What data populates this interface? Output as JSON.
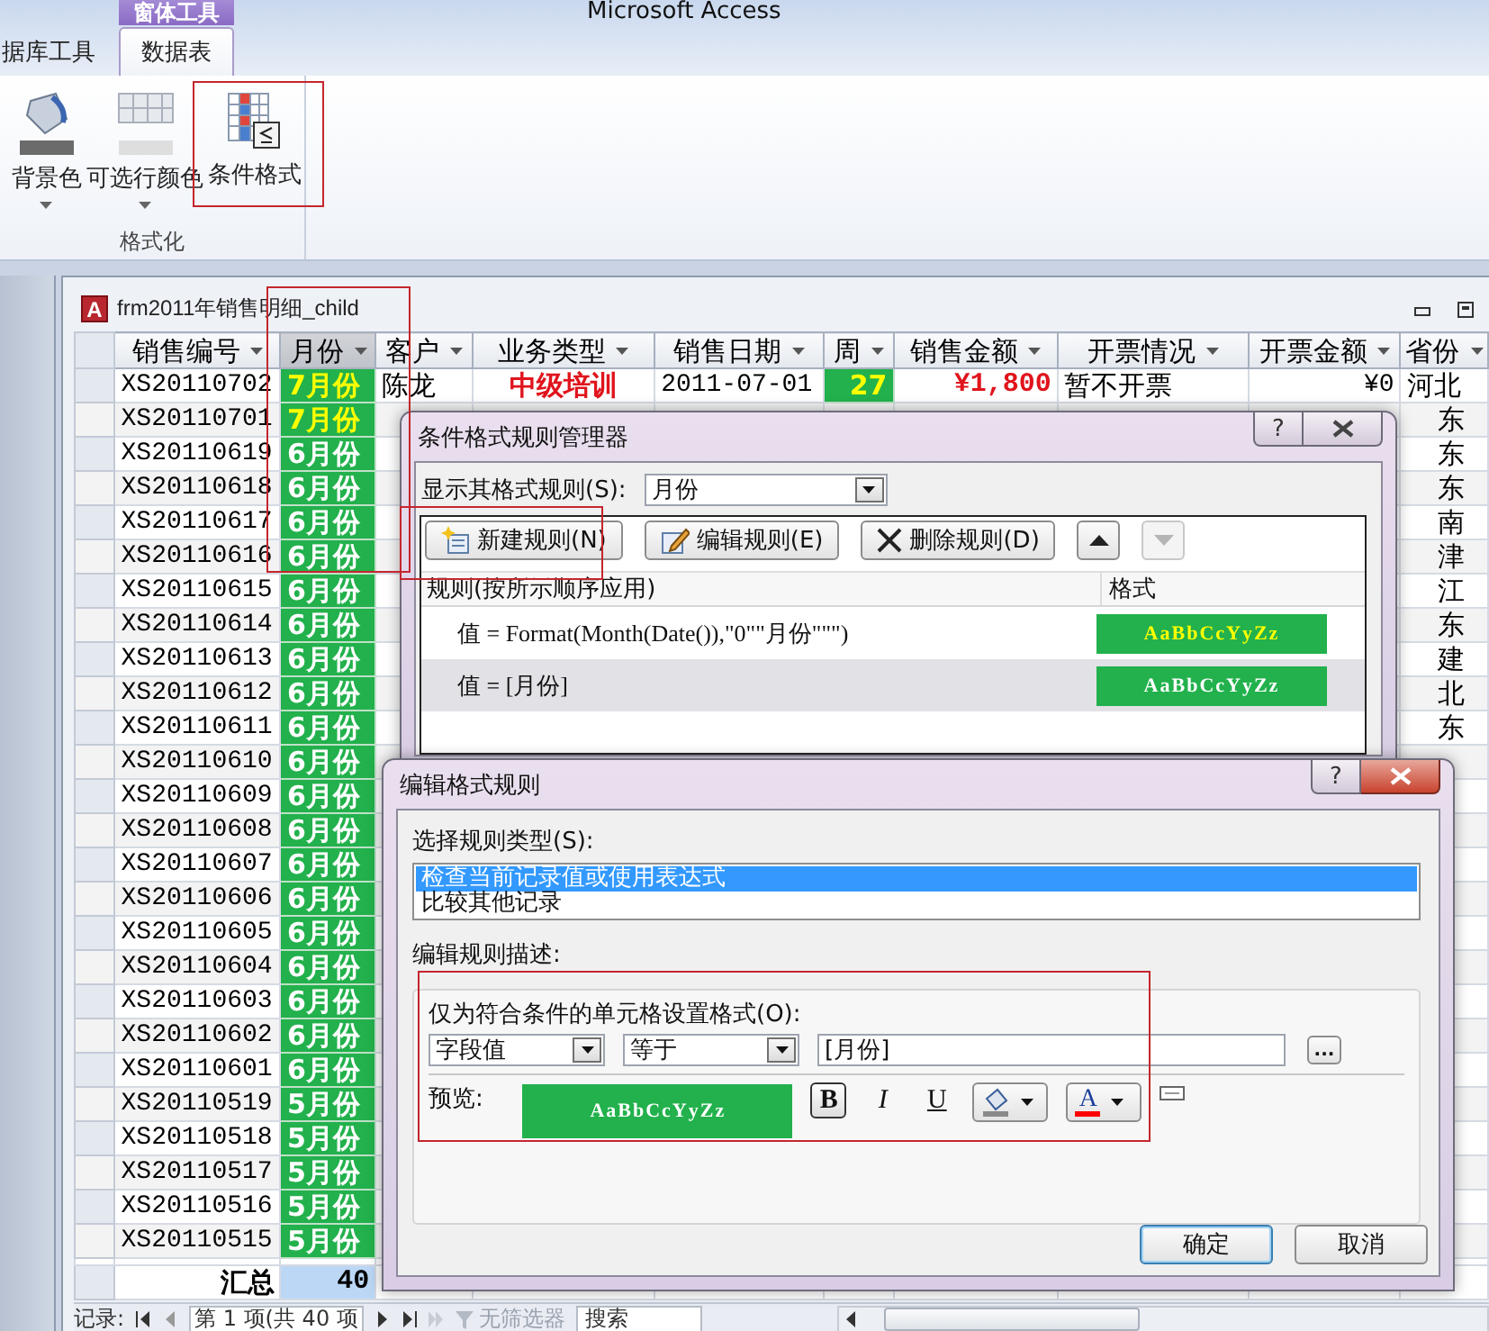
{
  "app": {
    "title": "Microsoft Access"
  },
  "ribbon": {
    "tabs": [
      {
        "label": "据库工具",
        "selected": false
      },
      {
        "label": "数据表",
        "selected": true,
        "group_label": "窗体工具"
      }
    ],
    "buttons": [
      {
        "label": "背景色",
        "kind": "bucket",
        "dropdown": true
      },
      {
        "label": "可选行颜色",
        "kind": "grid",
        "dropdown": true
      },
      {
        "label": "条件格式",
        "kind": "conditional",
        "dropdown": false
      }
    ],
    "group_label": "格式化"
  },
  "form": {
    "icon_letter": "A",
    "title": "frm2011年销售明细_child",
    "columns": [
      {
        "label": "销售编号",
        "selected": false
      },
      {
        "label": "月份",
        "selected": true
      },
      {
        "label": "客户",
        "selected": false
      },
      {
        "label": "业务类型",
        "selected": false
      },
      {
        "label": "销售日期",
        "selected": false
      },
      {
        "label": "周",
        "selected": false
      },
      {
        "label": "销售金额",
        "selected": false
      },
      {
        "label": "开票情况",
        "selected": false
      },
      {
        "label": "开票金额",
        "selected": false
      },
      {
        "label": "省份",
        "selected": false
      }
    ],
    "rows": [
      {
        "id": "XS20110702",
        "month": {
          "text": "7月份",
          "current": true
        },
        "customer": "陈龙",
        "business_type": "中级培训",
        "date": "2011-07-01",
        "week": {
          "text": "27",
          "current": true
        },
        "amount": "¥1,800",
        "invoice": "暂不开票",
        "invoice_amount": "¥0",
        "province": "河北"
      },
      {
        "id": "XS20110701",
        "month": {
          "text": "7月份",
          "current": true
        },
        "province": "东"
      },
      {
        "id": "XS20110619",
        "month": {
          "text": "6月份",
          "current": false
        },
        "province": "东"
      },
      {
        "id": "XS20110618",
        "month": {
          "text": "6月份",
          "current": false
        },
        "province": "东"
      },
      {
        "id": "XS20110617",
        "month": {
          "text": "6月份",
          "current": false
        },
        "province": "南"
      },
      {
        "id": "XS20110616",
        "month": {
          "text": "6月份",
          "current": false
        },
        "province": "津"
      },
      {
        "id": "XS20110615",
        "month": {
          "text": "6月份",
          "current": false
        },
        "province": "江"
      },
      {
        "id": "XS20110614",
        "month": {
          "text": "6月份",
          "current": false
        },
        "province": "东"
      },
      {
        "id": "XS20110613",
        "month": {
          "text": "6月份",
          "current": false
        },
        "province": "建"
      },
      {
        "id": "XS20110612",
        "month": {
          "text": "6月份",
          "current": false
        },
        "province": "北"
      },
      {
        "id": "XS20110611",
        "month": {
          "text": "6月份",
          "current": false
        },
        "province": "东"
      },
      {
        "id": "XS20110610",
        "month": {
          "text": "6月份",
          "current": false
        }
      },
      {
        "id": "XS20110609",
        "month": {
          "text": "6月份",
          "current": false
        }
      },
      {
        "id": "XS20110608",
        "month": {
          "text": "6月份",
          "current": false
        }
      },
      {
        "id": "XS20110607",
        "month": {
          "text": "6月份",
          "current": false
        }
      },
      {
        "id": "XS20110606",
        "month": {
          "text": "6月份",
          "current": false
        }
      },
      {
        "id": "XS20110605",
        "month": {
          "text": "6月份",
          "current": false
        }
      },
      {
        "id": "XS20110604",
        "month": {
          "text": "6月份",
          "current": false
        }
      },
      {
        "id": "XS20110603",
        "month": {
          "text": "6月份",
          "current": false
        }
      },
      {
        "id": "XS20110602",
        "month": {
          "text": "6月份",
          "current": false
        }
      },
      {
        "id": "XS20110601",
        "month": {
          "text": "6月份",
          "current": false
        }
      },
      {
        "id": "XS20110519",
        "month": {
          "text": "5月份",
          "current": false
        }
      },
      {
        "id": "XS20110518",
        "month": {
          "text": "5月份",
          "current": false
        }
      },
      {
        "id": "XS20110517",
        "month": {
          "text": "5月份",
          "current": false
        }
      },
      {
        "id": "XS20110516",
        "month": {
          "text": "5月份",
          "current": false
        }
      },
      {
        "id": "XS20110515",
        "month": {
          "text": "5月份",
          "current": false
        }
      }
    ],
    "total": {
      "label": "汇总",
      "value": "40"
    }
  },
  "navigation": {
    "label": "记录:",
    "position": "第 1 项(共 40 项",
    "filter": "无筛选器",
    "search": "搜索"
  },
  "rule_manager": {
    "title": "条件格式规则管理器",
    "help": "?",
    "show_label": "显示其格式规则(S):",
    "show_value": "月份",
    "buttons": [
      {
        "kind": "new",
        "label": "新建规则(N)",
        "disabled": false
      },
      {
        "kind": "edit",
        "label": "编辑规则(E)",
        "disabled": false
      },
      {
        "kind": "delete",
        "label": "删除规则(D)",
        "disabled": false
      },
      {
        "kind": "up",
        "disabled": false
      },
      {
        "kind": "down",
        "disabled": true
      }
    ],
    "columns": [
      "规则(按所示顺序应用)",
      "格式"
    ],
    "rules": [
      {
        "rule": "值 = Format(Month(Date()),\"0\"\"月份\"\"\")",
        "preview": "AaBbCcYyZz",
        "current": true,
        "selected": false
      },
      {
        "rule": "值 = [月份]",
        "preview": "AaBbCcYyZz",
        "current": false,
        "selected": true
      }
    ]
  },
  "rule_editor": {
    "title": "编辑格式规则",
    "help": "?",
    "type_label": "选择规则类型(S):",
    "types": [
      {
        "label": "检查当前记录值或使用表达式",
        "selected": true
      },
      {
        "label": "比较其他记录",
        "selected": false
      }
    ],
    "description_label": "编辑规则描述:",
    "condition_label": "仅为符合条件的单元格设置格式(O):",
    "field_combo": "字段值",
    "operator_combo": "等于",
    "expression": "[月份]",
    "builder_button": "...",
    "preview_label": "预览:",
    "preview": "AaBbCcYyZz",
    "format_buttons": [
      {
        "kind": "bold",
        "label": "B",
        "pressed": true
      },
      {
        "kind": "italic",
        "label": "I",
        "pressed": false
      },
      {
        "kind": "underline",
        "label": "U",
        "pressed": false
      }
    ],
    "font_color": {
      "label": "A",
      "color": "#ff0000"
    },
    "ok": "确定",
    "cancel": "取消"
  }
}
